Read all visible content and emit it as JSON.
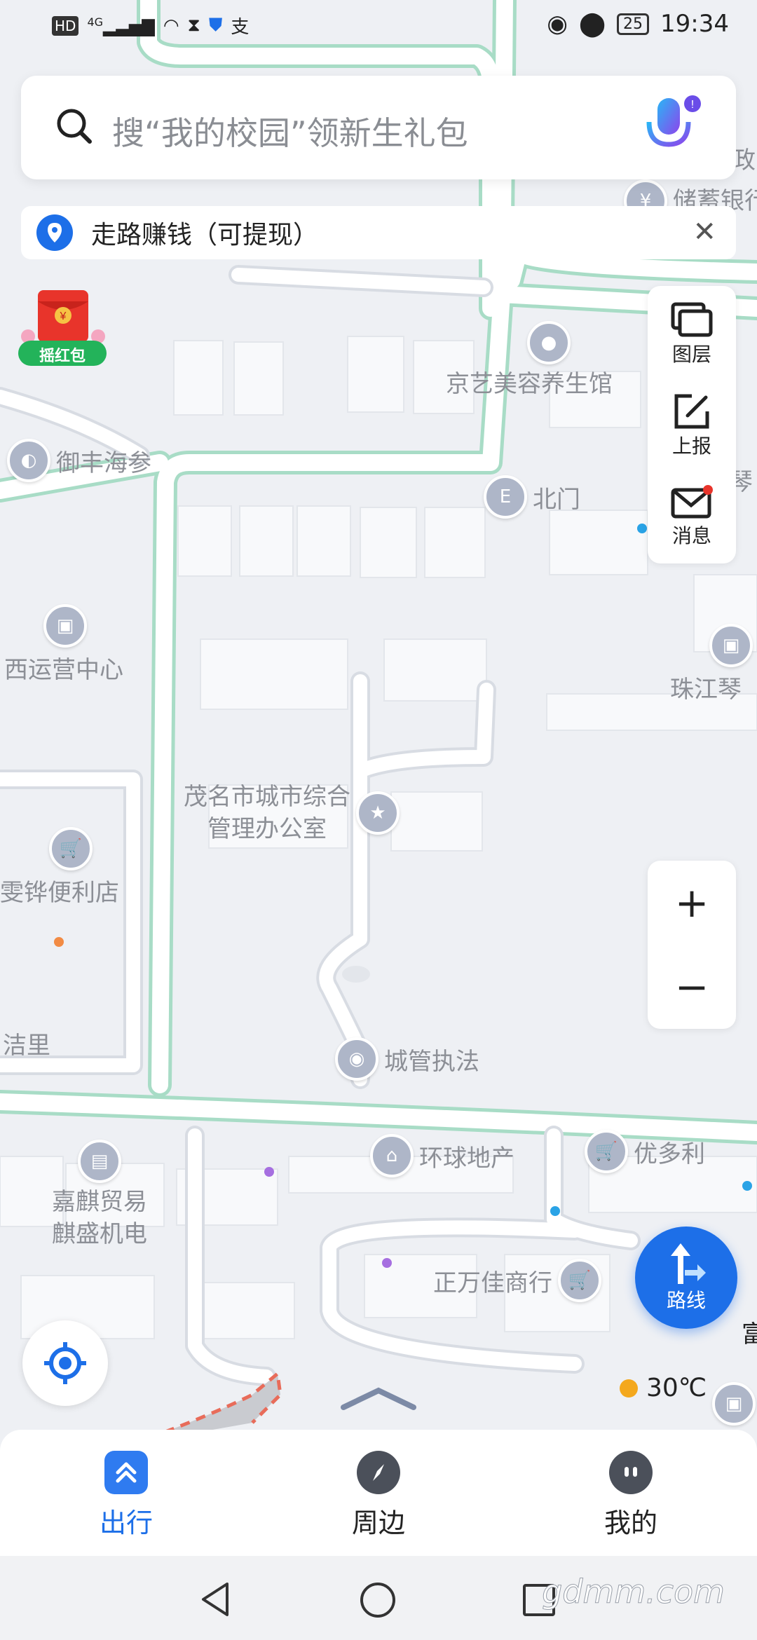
{
  "status_bar": {
    "left_hd": "HD",
    "left_signal": "4G",
    "left_pay": "支",
    "battery": "25",
    "time": "19:34"
  },
  "search": {
    "placeholder": "搜“我的校园”领新生礼包"
  },
  "banner": {
    "text": "走路赚钱（可提现）"
  },
  "red_packet": {
    "label": "摇红包"
  },
  "tools": [
    {
      "label": "图层"
    },
    {
      "label": "上报"
    },
    {
      "label": "消息"
    }
  ],
  "zoom": {
    "in": "+",
    "out": "−"
  },
  "map_labels": {
    "bank": "储蓄银行",
    "bank_top": "邮政",
    "jingyi": "京艺美容养生馆",
    "yufeng": "御丰海参",
    "north_gate": "北门",
    "qin_top": "琴",
    "xiyun": "西运营中心",
    "zhujiang": "珠江琴",
    "chengguan_office": "茂名市城市综合\n管理办公室",
    "store": "雯铧便利店",
    "jieli": "洁里",
    "law": "城管执法",
    "huanqiu": "环球地产",
    "youduoli": "优多利",
    "jiaqi": "嘉麒贸易\n麒盛机电",
    "zhengwanjia": "正万佳商行",
    "fu": "富"
  },
  "route_button": {
    "label": "路线"
  },
  "weather": {
    "temp": "30℃"
  },
  "bottom_tabs": [
    {
      "label": "出行"
    },
    {
      "label": "周边"
    },
    {
      "label": "我的"
    }
  ],
  "watermark": "gdmm.com",
  "colors": {
    "accent": "#1d6fe8",
    "road_border": "#9fd9c0",
    "map_bg": "#eef0f4"
  }
}
